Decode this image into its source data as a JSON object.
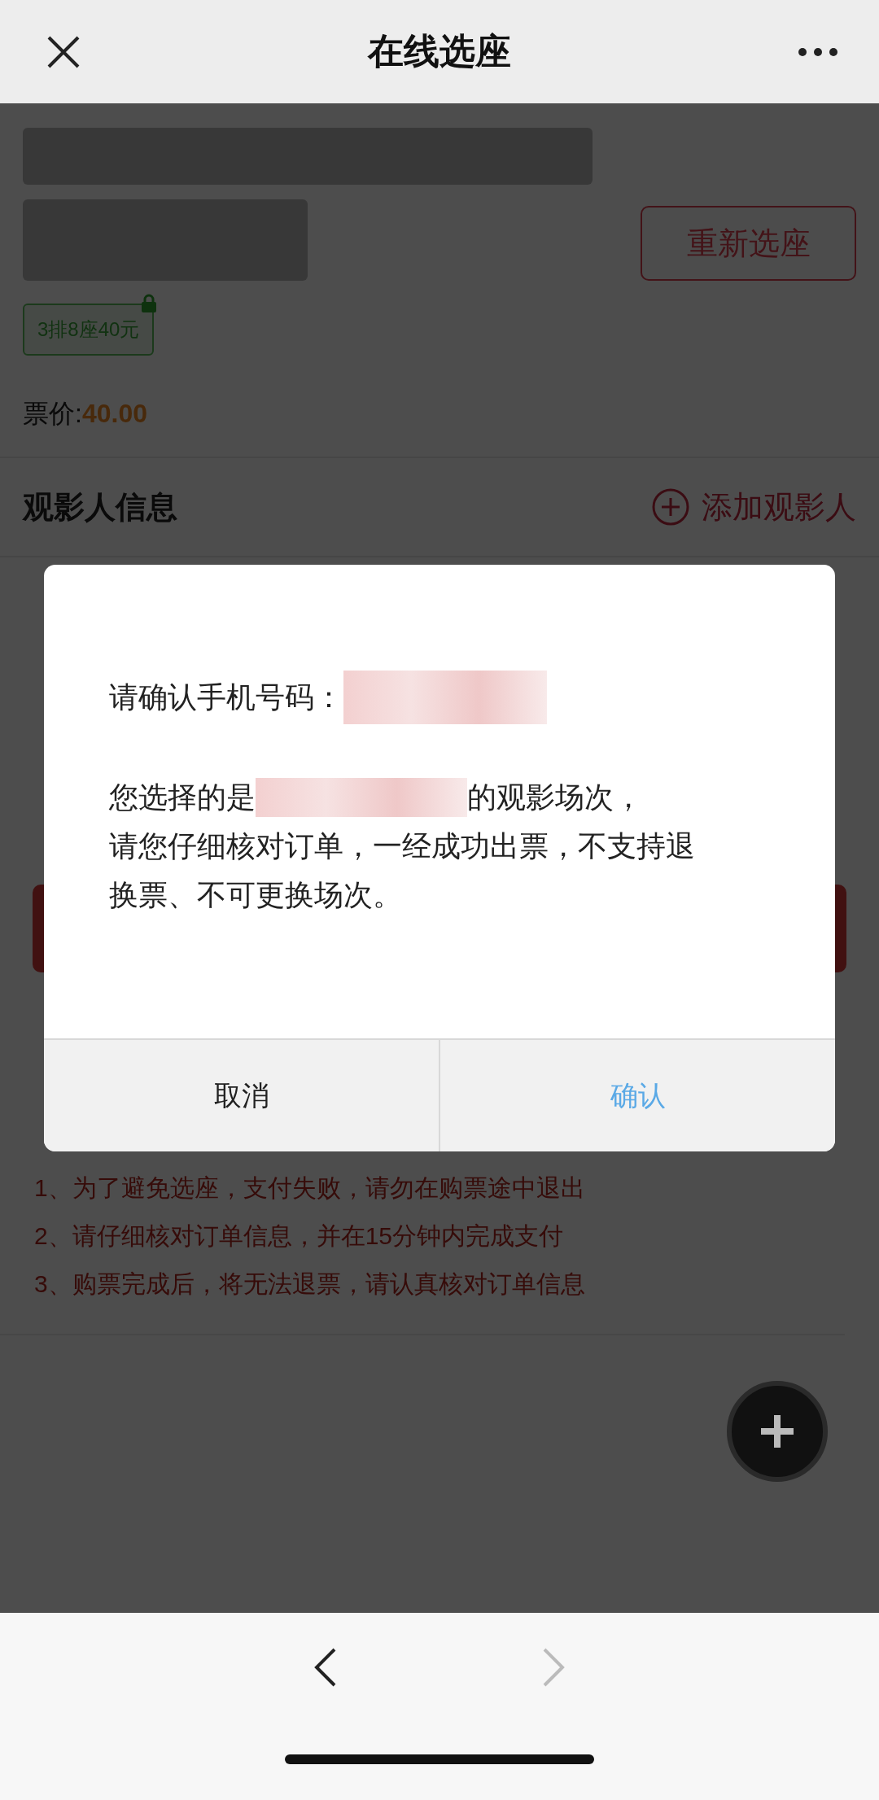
{
  "nav": {
    "title": "在线选座"
  },
  "order": {
    "reselect_button": "重新选座",
    "seat_tag": "3排8座40元",
    "seat_locked": true,
    "price_label": "票价:",
    "price": "40.00"
  },
  "viewers": {
    "title": "观影人信息",
    "add_button": "添加观影人"
  },
  "notes": [
    "1、为了避免选座，支付失败，请勿在购票途中退出",
    "2、请仔细核对订单信息，并在15分钟内完成支付",
    "3、购票完成后，将无法退票，请认真核对订单信息"
  ],
  "dialog": {
    "phone_label": "请确认手机号码：",
    "message_before": "您选择的是",
    "message_after": "的观影场次，",
    "message_rest": "请您仔细核对订单，一经成功出票，不支持退换票、不可更换场次。",
    "buttons": [
      {
        "label": "取消",
        "kind": "cancel"
      },
      {
        "label": "确认",
        "kind": "confirm"
      }
    ]
  },
  "browser": {
    "back_disabled": false,
    "forward_disabled": true
  }
}
